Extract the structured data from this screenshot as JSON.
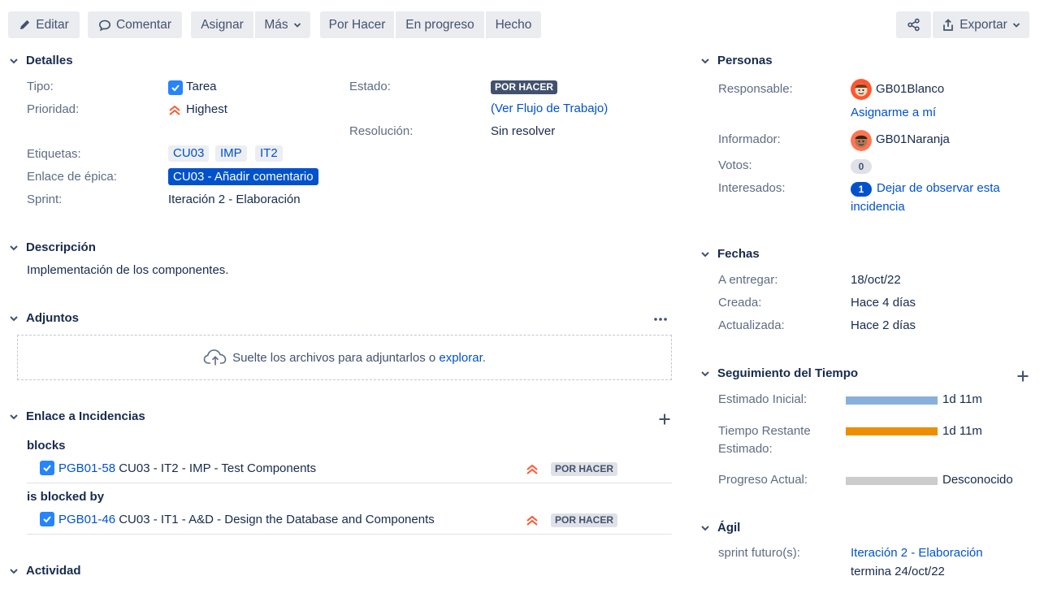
{
  "toolbar": {
    "edit": "Editar",
    "comment": "Comentar",
    "assign": "Asignar",
    "more": "Más",
    "todo": "Por Hacer",
    "in_progress": "En progreso",
    "done": "Hecho",
    "export": "Exportar"
  },
  "details": {
    "title": "Detalles",
    "type_label": "Tipo:",
    "type_value": "Tarea",
    "priority_label": "Prioridad:",
    "priority_value": "Highest",
    "labels_label": "Etiquetas:",
    "labels": [
      "CU03",
      "IMP",
      "IT2"
    ],
    "epic_label": "Enlace de épica:",
    "epic_value": "CU03 - Añadir comentario",
    "sprint_label": "Sprint:",
    "sprint_value": "Iteración 2 - Elaboración",
    "status_label": "Estado:",
    "status_value": "POR HACER",
    "workflow_open": "(",
    "workflow_link": "Ver Flujo de Trabajo",
    "workflow_close": ")",
    "resolution_label": "Resolución:",
    "resolution_value": "Sin resolver"
  },
  "description": {
    "title": "Descripción",
    "text": "Implementación de los componentes."
  },
  "attachments": {
    "title": "Adjuntos",
    "drop_text": "Suelte los archivos para adjuntarlos o ",
    "browse": "explorar",
    "period": "."
  },
  "links": {
    "title": "Enlace a Incidencias",
    "groups": [
      {
        "relation": "blocks",
        "key": "PGB01-58",
        "summary": "CU03 - IT2 - IMP - Test Components",
        "status": "POR HACER"
      },
      {
        "relation": "is blocked by",
        "key": "PGB01-46",
        "summary": "CU03 - IT1 - A&D - Design the Database and Components",
        "status": "POR HACER"
      }
    ]
  },
  "activity": {
    "title": "Actividad"
  },
  "people": {
    "title": "Personas",
    "assignee_label": "Responsable:",
    "assignee": "GB01Blanco",
    "assign_me": "Asignarme a mí",
    "reporter_label": "Informador:",
    "reporter": "GB01Naranja",
    "votes_label": "Votos:",
    "votes": "0",
    "watchers_label": "Interesados:",
    "watchers": "1",
    "watch_line1": "Dejar de observar esta",
    "watch_line2": "incidencia"
  },
  "dates": {
    "title": "Fechas",
    "due_label": "A entregar:",
    "due": "18/oct/22",
    "created_label": "Creada:",
    "created": "Hace 4 días",
    "updated_label": "Actualizada:",
    "updated": "Hace 2 días"
  },
  "time": {
    "title": "Seguimiento del Tiempo",
    "original_label": "Estimado Inicial:",
    "original": "1d 11m",
    "remaining_label1": "Tiempo Restante",
    "remaining_label2": "Estimado:",
    "remaining": "1d 11m",
    "logged_label": "Progreso Actual:",
    "logged": "Desconocido",
    "colors": {
      "original": "#89b0da",
      "remaining": "#ec8e00",
      "logged": "#cccccc"
    }
  },
  "agile": {
    "title": "Ágil",
    "future_label": "sprint futuro(s):",
    "sprint_link": "Iteración 2 - Elaboración",
    "sprint_end": "termina 24/oct/22"
  }
}
